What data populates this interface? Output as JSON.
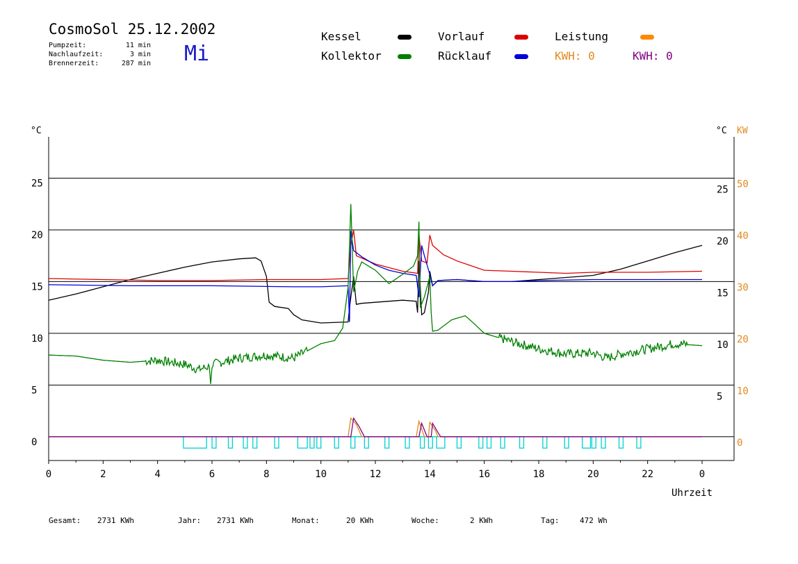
{
  "header": {
    "title": "CosmoSol 25.12.2002",
    "weekday": "Mi",
    "stats": [
      {
        "label": "Pumpzeit:",
        "value": "11 min"
      },
      {
        "label": "Nachlaufzeit:",
        "value": "3 min"
      },
      {
        "label": "Brennerzeit:",
        "value": "287 min"
      }
    ]
  },
  "legend": {
    "items": [
      {
        "label": "Kessel",
        "color": "#000000"
      },
      {
        "label": "Vorlauf",
        "color": "#dd0000"
      },
      {
        "label": "Leistung",
        "color": "#ff8800"
      },
      {
        "label": "Kollektor",
        "color": "#008000"
      },
      {
        "label": "Rücklauf",
        "color": "#0000dd"
      }
    ],
    "kwh": [
      {
        "text": "KWH: 0",
        "color": "#e08a1e"
      },
      {
        "text": "KWH: 0",
        "color": "#800080"
      }
    ]
  },
  "footer": [
    {
      "label": "Gesamt:",
      "value": "2731 KWh"
    },
    {
      "label": "Jahr:",
      "value": "2731 KWh"
    },
    {
      "label": "Monat:",
      "value": "20 KWh"
    },
    {
      "label": "Woche:",
      "value": "2 KWh"
    },
    {
      "label": "Tag:",
      "value": "472 Wh"
    }
  ],
  "chart_data": {
    "type": "line",
    "xlabel": "Uhrzeit",
    "x_ticks": [
      "0",
      "2",
      "4",
      "6",
      "8",
      "10",
      "12",
      "14",
      "16",
      "18",
      "20",
      "22",
      "0"
    ],
    "xlim": [
      0,
      24
    ],
    "ylim": [
      -2.3,
      29
    ],
    "left_axis": {
      "unit": "°C",
      "ticks": [
        0,
        5,
        10,
        15,
        20,
        25
      ]
    },
    "right_axis_temp": {
      "unit": "°C",
      "ticks": [
        5,
        10,
        15,
        20,
        25
      ]
    },
    "right_axis_power": {
      "unit": "KW",
      "color": "#e08a1e",
      "ticks": [
        0,
        10,
        20,
        30,
        40,
        50
      ]
    },
    "grid_lines": [
      0,
      5,
      10,
      15,
      20,
      25
    ],
    "series": [
      {
        "name": "Kessel",
        "color": "#000000",
        "points": [
          [
            0,
            13.2
          ],
          [
            1,
            13.8
          ],
          [
            2,
            14.5
          ],
          [
            3,
            15.2
          ],
          [
            4,
            15.8
          ],
          [
            5,
            16.4
          ],
          [
            6,
            16.9
          ],
          [
            7,
            17.2
          ],
          [
            7.6,
            17.3
          ],
          [
            7.8,
            17.0
          ],
          [
            8.0,
            15.5
          ],
          [
            8.1,
            13.0
          ],
          [
            8.3,
            12.6
          ],
          [
            8.8,
            12.4
          ],
          [
            9.0,
            11.8
          ],
          [
            9.3,
            11.3
          ],
          [
            10.0,
            11.0
          ],
          [
            11.0,
            11.1
          ],
          [
            11.05,
            12.5
          ],
          [
            11.2,
            15.5
          ],
          [
            11.3,
            12.8
          ],
          [
            11.5,
            12.9
          ],
          [
            12,
            13.0
          ],
          [
            13,
            13.2
          ],
          [
            13.5,
            13.1
          ],
          [
            13.55,
            12.0
          ],
          [
            13.6,
            17.0
          ],
          [
            13.7,
            11.8
          ],
          [
            13.8,
            12.0
          ],
          [
            13.95,
            14.0
          ],
          [
            14.0,
            16.0
          ],
          [
            14.1,
            14.6
          ],
          [
            14.3,
            15.1
          ],
          [
            15,
            15.2
          ],
          [
            16,
            15.0
          ],
          [
            17,
            15.0
          ],
          [
            18,
            15.2
          ],
          [
            19,
            15.4
          ],
          [
            20,
            15.6
          ],
          [
            21,
            16.2
          ],
          [
            22,
            17.0
          ],
          [
            23,
            17.8
          ],
          [
            24,
            18.5
          ]
        ]
      },
      {
        "name": "Vorlauf",
        "color": "#dd0000",
        "points": [
          [
            0,
            15.3
          ],
          [
            2,
            15.2
          ],
          [
            4,
            15.1
          ],
          [
            6,
            15.1
          ],
          [
            8,
            15.2
          ],
          [
            10,
            15.2
          ],
          [
            11.0,
            15.3
          ],
          [
            11.1,
            18.5
          ],
          [
            11.2,
            20.0
          ],
          [
            11.3,
            17.5
          ],
          [
            12,
            16.7
          ],
          [
            13,
            16.0
          ],
          [
            13.55,
            15.8
          ],
          [
            13.6,
            19.5
          ],
          [
            13.7,
            17.0
          ],
          [
            13.9,
            16.8
          ],
          [
            14.0,
            19.5
          ],
          [
            14.1,
            18.5
          ],
          [
            14.5,
            17.6
          ],
          [
            15,
            17.0
          ],
          [
            16,
            16.1
          ],
          [
            17,
            16.0
          ],
          [
            18,
            15.9
          ],
          [
            19,
            15.8
          ],
          [
            20,
            15.9
          ],
          [
            22,
            15.9
          ],
          [
            24,
            16.0
          ]
        ]
      },
      {
        "name": "Rücklauf",
        "color": "#0000dd",
        "points": [
          [
            0,
            14.7
          ],
          [
            3,
            14.6
          ],
          [
            6,
            14.6
          ],
          [
            9,
            14.5
          ],
          [
            10,
            14.5
          ],
          [
            11.0,
            14.6
          ],
          [
            11.05,
            11.1
          ],
          [
            11.1,
            19.9
          ],
          [
            11.2,
            18.0
          ],
          [
            11.5,
            17.4
          ],
          [
            12,
            16.6
          ],
          [
            12.5,
            16.1
          ],
          [
            13,
            15.8
          ],
          [
            13.5,
            15.6
          ],
          [
            13.6,
            13.5
          ],
          [
            13.7,
            18.5
          ],
          [
            13.8,
            17.5
          ],
          [
            14.0,
            15.7
          ],
          [
            14.1,
            14.6
          ],
          [
            14.3,
            15.1
          ],
          [
            15,
            15.2
          ],
          [
            16,
            15.0
          ],
          [
            17,
            15.0
          ],
          [
            18,
            15.1
          ],
          [
            20,
            15.2
          ],
          [
            22,
            15.2
          ],
          [
            24,
            15.2
          ]
        ]
      },
      {
        "name": "Kollektor",
        "color": "#008000",
        "points": [
          [
            0,
            7.9
          ],
          [
            1,
            7.8
          ],
          [
            2,
            7.4
          ],
          [
            3,
            7.2
          ],
          [
            4,
            7.4
          ],
          [
            4.5,
            7.2
          ],
          [
            5,
            7.0
          ],
          [
            5.5,
            6.5
          ],
          [
            5.9,
            6.8
          ],
          [
            5.95,
            5.1
          ],
          [
            6,
            7.0
          ],
          [
            7,
            7.6
          ],
          [
            8,
            7.9
          ],
          [
            9,
            7.6
          ],
          [
            9.5,
            8.3
          ],
          [
            10,
            9.0
          ],
          [
            10.5,
            9.3
          ],
          [
            10.8,
            10.5
          ],
          [
            11.0,
            14.5
          ],
          [
            11.1,
            22.5
          ],
          [
            11.2,
            14.0
          ],
          [
            11.35,
            16.0
          ],
          [
            11.5,
            16.9
          ],
          [
            12,
            16.1
          ],
          [
            12.5,
            14.8
          ],
          [
            13,
            15.7
          ],
          [
            13.4,
            16.5
          ],
          [
            13.55,
            17.5
          ],
          [
            13.6,
            20.8
          ],
          [
            13.65,
            12.5
          ],
          [
            13.8,
            13.5
          ],
          [
            14.0,
            15.5
          ],
          [
            14.05,
            12.0
          ],
          [
            14.1,
            10.2
          ],
          [
            14.3,
            10.3
          ],
          [
            14.8,
            11.3
          ],
          [
            15.3,
            11.7
          ],
          [
            15.6,
            11.0
          ],
          [
            16,
            10.0
          ],
          [
            17,
            9.2
          ],
          [
            18,
            8.5
          ],
          [
            19,
            8.0
          ],
          [
            20,
            8.1
          ],
          [
            20.5,
            7.6
          ],
          [
            21,
            8.0
          ],
          [
            22,
            8.5
          ],
          [
            23,
            9.0
          ],
          [
            24,
            8.8
          ]
        ]
      },
      {
        "name": "Leistung",
        "color": "#e08a1e",
        "points": [
          [
            0,
            0
          ],
          [
            11.0,
            0
          ],
          [
            11.1,
            1.8
          ],
          [
            11.3,
            1.2
          ],
          [
            11.5,
            0
          ],
          [
            13.5,
            0
          ],
          [
            13.6,
            1.5
          ],
          [
            13.8,
            0
          ],
          [
            13.95,
            0
          ],
          [
            14.0,
            1.4
          ],
          [
            14.2,
            0.6
          ],
          [
            14.3,
            0
          ],
          [
            24,
            0
          ]
        ]
      },
      {
        "name": "Leistung (KWH)",
        "color": "#800080",
        "points": [
          [
            0,
            0
          ],
          [
            11.1,
            0
          ],
          [
            11.2,
            1.8
          ],
          [
            11.4,
            1.0
          ],
          [
            11.6,
            0
          ],
          [
            13.6,
            0
          ],
          [
            13.7,
            1.3
          ],
          [
            13.9,
            0
          ],
          [
            14.05,
            0
          ],
          [
            14.1,
            1.3
          ],
          [
            14.3,
            0.4
          ],
          [
            14.4,
            0
          ],
          [
            24,
            0
          ]
        ]
      }
    ],
    "pump_pulses": {
      "color": "#00d0d0",
      "intervals": [
        [
          4.95,
          5.8
        ],
        [
          6.0,
          6.15
        ],
        [
          6.6,
          6.75
        ],
        [
          7.15,
          7.3
        ],
        [
          7.5,
          7.65
        ],
        [
          8.3,
          8.45
        ],
        [
          9.15,
          9.5
        ],
        [
          9.6,
          9.75
        ],
        [
          9.85,
          10.0
        ],
        [
          10.5,
          10.65
        ],
        [
          11.1,
          11.25
        ],
        [
          11.6,
          11.75
        ],
        [
          12.35,
          12.5
        ],
        [
          13.1,
          13.25
        ],
        [
          13.65,
          13.8
        ],
        [
          13.95,
          14.1
        ],
        [
          14.25,
          14.55
        ],
        [
          15.0,
          15.15
        ],
        [
          15.8,
          15.95
        ],
        [
          16.1,
          16.25
        ],
        [
          16.6,
          16.75
        ],
        [
          17.3,
          17.45
        ],
        [
          18.15,
          18.3
        ],
        [
          18.95,
          19.1
        ],
        [
          19.6,
          19.9
        ],
        [
          19.95,
          20.1
        ],
        [
          20.3,
          20.45
        ],
        [
          20.95,
          21.1
        ],
        [
          21.6,
          21.75
        ]
      ]
    }
  }
}
